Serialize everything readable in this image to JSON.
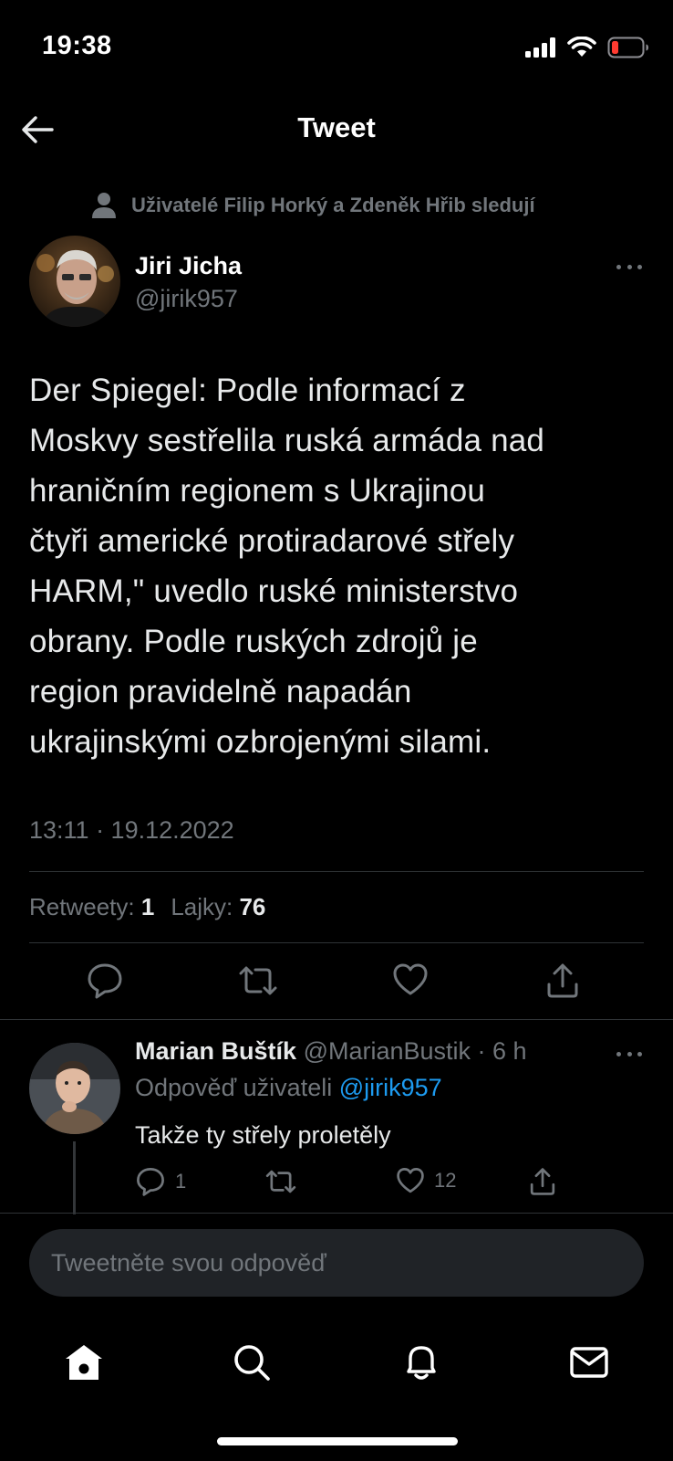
{
  "status_bar": {
    "time": "19:38",
    "icons": [
      "signal-icon",
      "wifi-icon",
      "battery-low-icon"
    ]
  },
  "header": {
    "title": "Tweet",
    "back_icon": "arrow-left-icon"
  },
  "social_context": {
    "text": "Uživatelé Filip Horký a Zdeněk Hřib sledují"
  },
  "tweet": {
    "author_name": "Jiri Jicha",
    "author_handle": "@jirik957",
    "text": "Der Spiegel: Podle informací z\nMoskvy sestřelila ruská armáda  nad\nhraničním regionem s Ukrajinou\nčtyři americké protiradarové střely\nHARM,\" uvedlo ruské ministerstvo\nobrany. Podle ruských zdrojů je\nregion pravidelně napadán\nukrajinskými ozbrojenými silami.",
    "timestamp": "13:11 · 19.12.2022",
    "retweets_label": "Retweety:",
    "retweets_count": "1",
    "likes_label": "Lajky:",
    "likes_count": "76"
  },
  "reply": {
    "author_name": "Marian Buštík",
    "meta": "@MarianBustik · 6 h",
    "reply_to_label": "Odpověď uživateli",
    "reply_to_handle": "@jirik957",
    "text": "Takže ty střely proletěly",
    "reply_count": "1",
    "retweet_count": "",
    "like_count": "12"
  },
  "compose": {
    "placeholder": "Tweetněte svou odpověď"
  },
  "tab_bar": {
    "items": [
      "home-icon",
      "search-icon",
      "notifications-icon",
      "messages-icon"
    ]
  },
  "colors": {
    "background": "#000000",
    "text": "#e7e9ea",
    "secondary": "#71767b",
    "accent": "#1d9bf0",
    "battery": "#ff3b30"
  }
}
